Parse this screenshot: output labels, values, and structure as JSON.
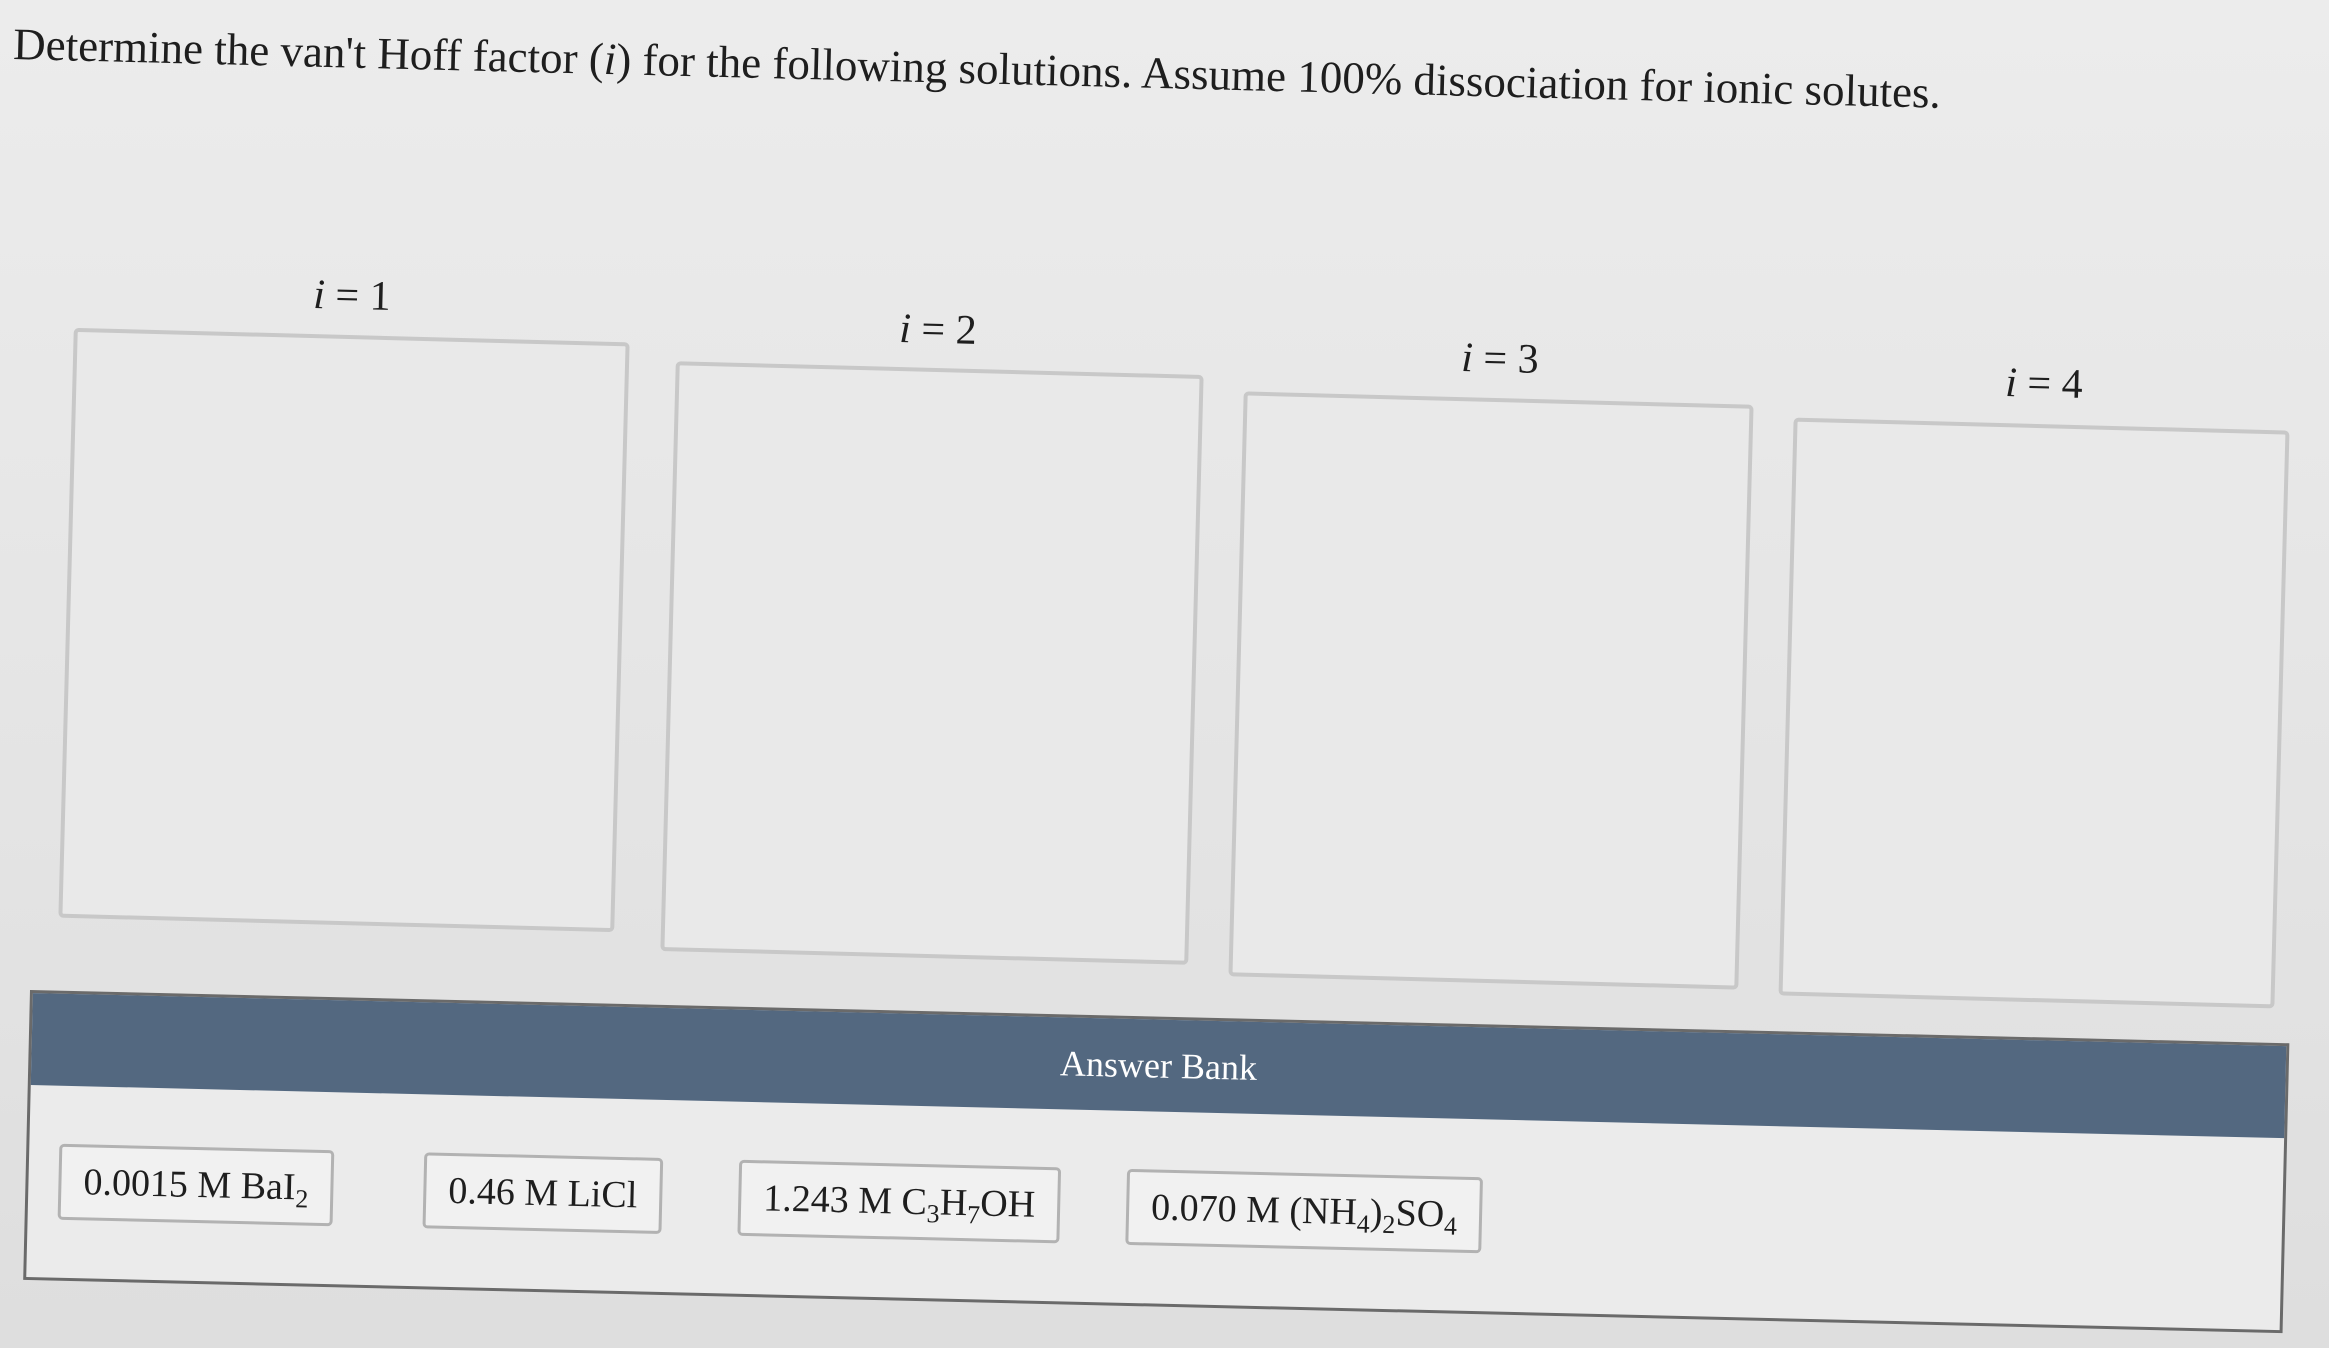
{
  "question": {
    "prefix": "Determine the van't Hoff factor (",
    "variable": "i",
    "suffix": ") for the following solutions. Assume 100% dissociation for ionic solutes."
  },
  "columns": [
    {
      "variable": "i",
      "value": " = 1"
    },
    {
      "variable": "i",
      "value": " = 2"
    },
    {
      "variable": "i",
      "value": " = 3"
    },
    {
      "variable": "i",
      "value": " = 4"
    }
  ],
  "answer_bank": {
    "title": "Answer Bank",
    "items": [
      {
        "parts": [
          "0.0015 M BaI",
          "2"
        ]
      },
      {
        "parts": [
          "0.46 M LiCl"
        ]
      },
      {
        "parts": [
          "1.243 M C",
          "3",
          "H",
          "7",
          "OH"
        ]
      },
      {
        "parts": [
          "0.070 M (NH",
          "4",
          ")",
          "2",
          "SO",
          "4"
        ]
      }
    ]
  }
}
